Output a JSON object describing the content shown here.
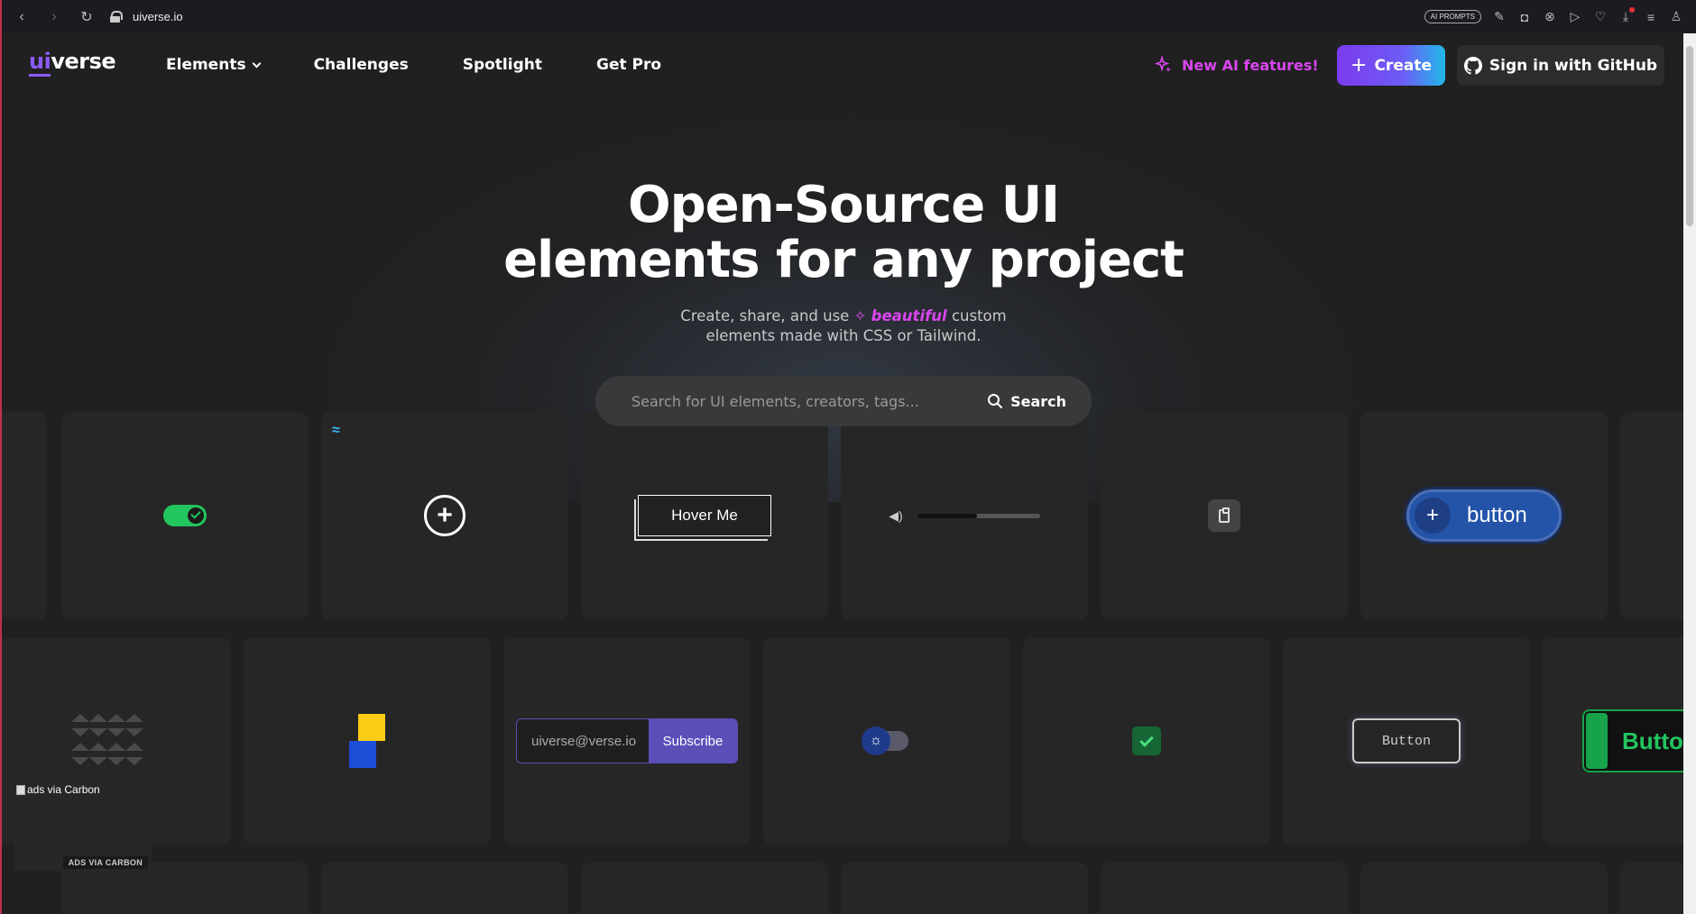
{
  "browser": {
    "url": "uiverse.io",
    "ai_prompts_label": "AI PROMPTS"
  },
  "header": {
    "logo_ui": "ui",
    "logo_rest": "verse",
    "nav": [
      "Elements",
      "Challenges",
      "Spotlight",
      "Get Pro"
    ],
    "ai_features": "New AI features!",
    "create_label": "Create",
    "github_label": "Sign in with GitHub"
  },
  "hero": {
    "title_line1": "Open-Source UI",
    "title_line2": "elements for any project",
    "sub_before": "Create, share, and use",
    "sub_highlight": "beautiful",
    "sub_after": "custom",
    "sub_line2": "elements made with CSS or Tailwind."
  },
  "search": {
    "placeholder": "Search for UI elements, creators, tags...",
    "button": "Search"
  },
  "cards": {
    "hover_me": "Hover Me",
    "blue_button": "button",
    "blue_plus": "+",
    "email": "uiverse@verse.io",
    "subscribe": "Subscribe",
    "outline_button": "Button",
    "green_button": "Button"
  },
  "carbon": {
    "alt_text": "ads via Carbon",
    "label": "ADS VIA CARBON"
  },
  "colors": {
    "accent": "#8b5cf6",
    "ai": "#d946ef",
    "background": "#202020",
    "card": "#262626"
  }
}
